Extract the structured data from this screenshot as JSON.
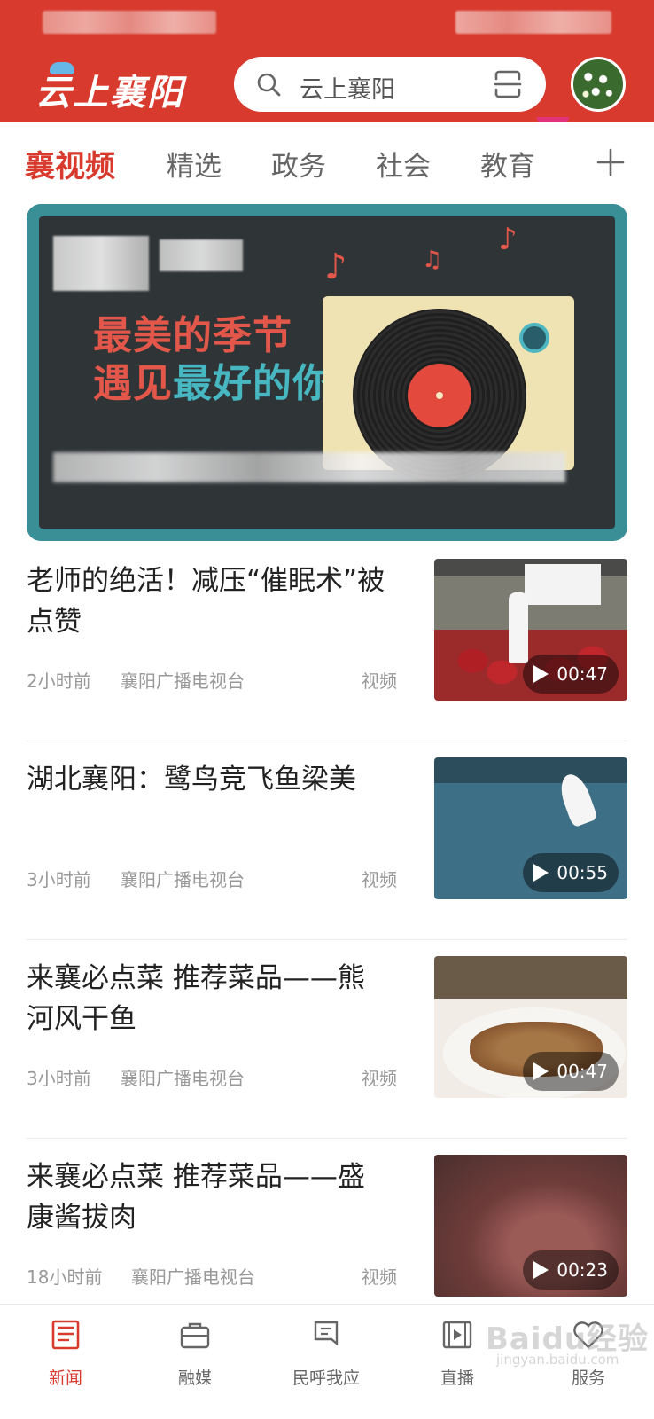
{
  "header": {
    "logo": "云上襄阳",
    "search_placeholder": "云上襄阳",
    "brand_color": "#d83a2e"
  },
  "tabs": [
    {
      "label": "襄视频",
      "active": true
    },
    {
      "label": "精选"
    },
    {
      "label": "政务"
    },
    {
      "label": "社会"
    },
    {
      "label": "教育"
    }
  ],
  "banner": {
    "line1": "最美的季节",
    "line2_red": "遇见",
    "line2_teal": "最好的你"
  },
  "articles": [
    {
      "title": "老师的绝活！减压“催眠术”被点赞",
      "time": "2小时前",
      "source": "襄阳广播电视台",
      "type": "视频",
      "duration": "00:47"
    },
    {
      "title": "湖北襄阳：鹭鸟竞飞鱼梁美",
      "time": "3小时前",
      "source": "襄阳广播电视台",
      "type": "视频",
      "duration": "00:55"
    },
    {
      "title": "来襄必点菜 推荐菜品——熊河风干鱼",
      "time": "3小时前",
      "source": "襄阳广播电视台",
      "type": "视频",
      "duration": "00:47"
    },
    {
      "title": "来襄必点菜 推荐菜品——盛康酱拔肉",
      "time": "18小时前",
      "source": "襄阳广播电视台",
      "type": "视频",
      "duration": "00:23"
    }
  ],
  "bottom_nav": [
    {
      "label": "新闻",
      "icon": "newspaper-icon",
      "active": true
    },
    {
      "label": "融媒",
      "icon": "briefcase-icon"
    },
    {
      "label": "民呼我应",
      "icon": "speech-icon"
    },
    {
      "label": "直播",
      "icon": "film-icon"
    },
    {
      "label": "服务",
      "icon": "heart-icon"
    }
  ],
  "watermark": {
    "text": "Baidu经验",
    "sub": "jingyan.baidu.com"
  }
}
